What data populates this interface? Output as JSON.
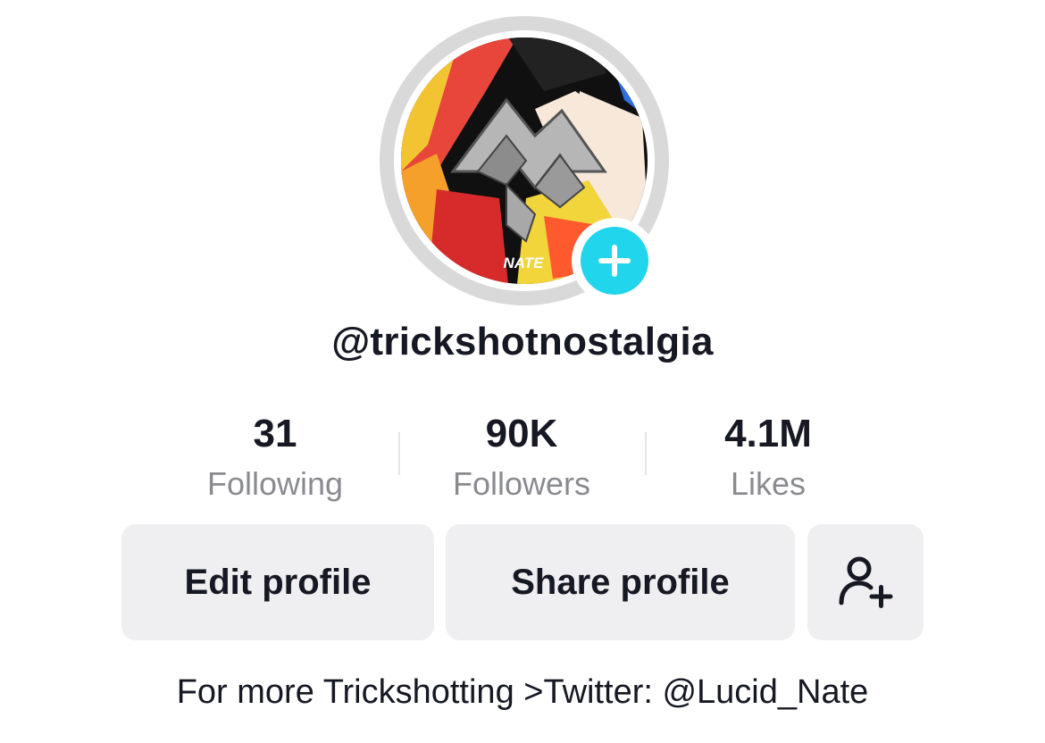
{
  "profile": {
    "username": "@trickshotnostalgia",
    "avatar_watermark": "NATE",
    "bio": "For more Trickshotting >Twitter: @Lucid_Nate"
  },
  "stats": {
    "following": {
      "value": "31",
      "label": "Following"
    },
    "followers": {
      "value": "90K",
      "label": "Followers"
    },
    "likes": {
      "value": "4.1M",
      "label": "Likes"
    }
  },
  "actions": {
    "edit_label": "Edit profile",
    "share_label": "Share profile",
    "add_friends_icon": "add-user-icon"
  },
  "icons": {
    "avatar_add": "plus-icon"
  },
  "colors": {
    "accent": "#20d5ec",
    "text_primary": "#161823",
    "text_secondary": "#8a8b91",
    "button_bg": "#efeff1",
    "avatar_ring": "#d9d9d9"
  }
}
